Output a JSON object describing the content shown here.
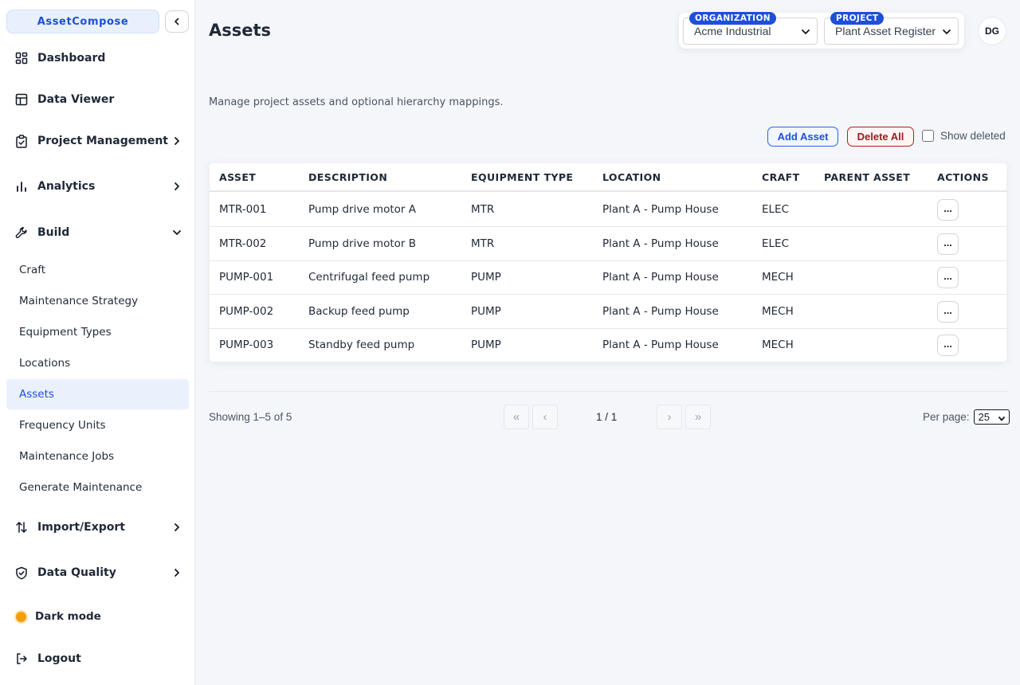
{
  "app": {
    "brand": "AssetCompose"
  },
  "sidebar": {
    "items": [
      {
        "label": "Dashboard"
      },
      {
        "label": "Data Viewer"
      },
      {
        "label": "Project Management"
      },
      {
        "label": "Analytics"
      },
      {
        "label": "Build"
      },
      {
        "label": "Import/Export"
      },
      {
        "label": "Data Quality"
      }
    ],
    "build_children": [
      {
        "label": "Craft"
      },
      {
        "label": "Maintenance Strategy"
      },
      {
        "label": "Equipment Types"
      },
      {
        "label": "Locations"
      },
      {
        "label": "Assets"
      },
      {
        "label": "Frequency Units"
      },
      {
        "label": "Maintenance Jobs"
      },
      {
        "label": "Generate Maintenance"
      }
    ],
    "dark_mode_label": "Dark mode",
    "logout_label": "Logout"
  },
  "header": {
    "title": "Assets",
    "organization": {
      "badge": "ORGANIZATION",
      "value": "Acme Industrial"
    },
    "project": {
      "badge": "PROJECT",
      "value": "Plant Asset Register"
    },
    "user_initials": "DG"
  },
  "main": {
    "subtitle": "Manage project assets and optional hierarchy mappings.",
    "add_button": "Add Asset",
    "delete_all_button": "Delete All",
    "show_deleted_label": "Show deleted"
  },
  "table": {
    "columns": [
      "ASSET",
      "DESCRIPTION",
      "EQUIPMENT TYPE",
      "LOCATION",
      "CRAFT",
      "PARENT ASSET",
      "ACTIONS"
    ],
    "rows": [
      {
        "asset": "MTR-001",
        "description": "Pump drive motor A",
        "equipment_type": "MTR",
        "location": "Plant A - Pump House",
        "craft": "ELEC",
        "parent": "",
        "action": "..."
      },
      {
        "asset": "MTR-002",
        "description": "Pump drive motor B",
        "equipment_type": "MTR",
        "location": "Plant A - Pump House",
        "craft": "ELEC",
        "parent": "",
        "action": "..."
      },
      {
        "asset": "PUMP-001",
        "description": "Centrifugal feed pump",
        "equipment_type": "PUMP",
        "location": "Plant A - Pump House",
        "craft": "MECH",
        "parent": "",
        "action": "..."
      },
      {
        "asset": "PUMP-002",
        "description": "Backup feed pump",
        "equipment_type": "PUMP",
        "location": "Plant A - Pump House",
        "craft": "MECH",
        "parent": "",
        "action": "..."
      },
      {
        "asset": "PUMP-003",
        "description": "Standby feed pump",
        "equipment_type": "PUMP",
        "location": "Plant A - Pump House",
        "craft": "MECH",
        "parent": "",
        "action": "..."
      }
    ]
  },
  "pagination": {
    "showing": "Showing 1–5 of 5",
    "first": "«",
    "prev": "‹",
    "page_info": "1 / 1",
    "next": "›",
    "last": "»",
    "per_page_label": "Per page:",
    "per_page_value": "25"
  },
  "colors": {
    "accent": "#1d4fd8",
    "danger": "#991b1b",
    "active_bg": "#eaf1fc"
  }
}
